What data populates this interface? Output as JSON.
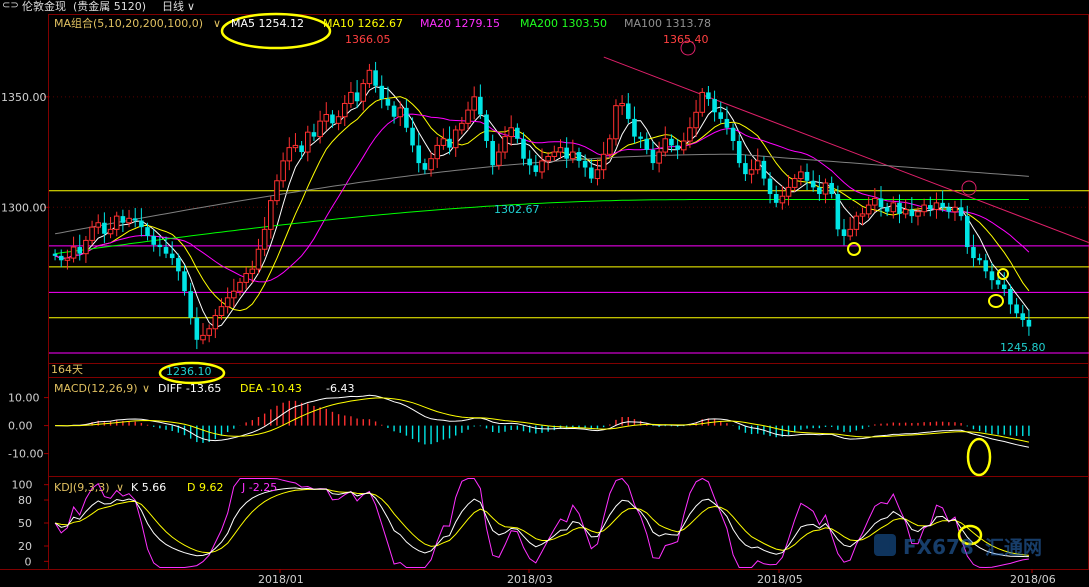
{
  "topbar": {
    "title": "伦敦金现",
    "category": "(贵金属  5120)",
    "period": "日线",
    "period_arrow": "∨"
  },
  "main_panel": {
    "ma_group_label": "MA组合(5,10,20,200,100,0)",
    "ma_group_arrow": "∨",
    "ma5": "MA5 1254.12",
    "ma10": "MA10 1262.67",
    "ma20": "MA20 1279.15",
    "ma200": "MA200 1303.50",
    "ma100": "MA100 1313.78",
    "high_label_1": "1366.05",
    "high_label_2": "1365.40",
    "low_label": "1236.10",
    "last_label": "1245.80",
    "mid_label": "1302.67",
    "days_label": "164天",
    "colors": {
      "ma5": "#ffffff",
      "ma10": "#ffff00",
      "ma20": "#ff00ff",
      "ma200": "#00ff00",
      "ma100": "#808080",
      "up_candle": "#ff3030",
      "down_candle": "#00e5e5",
      "hline_yellow": "#ffff00",
      "hline_magenta": "#ff00ff",
      "trendline": "#e0206a",
      "highlight_circle": "#ffff00"
    }
  },
  "macd_panel": {
    "label": "MACD(12,26,9)",
    "arrow": "∨",
    "diff": "DIFF -13.65",
    "dea": "DEA -10.43",
    "macd": "-6.43"
  },
  "kdj_panel": {
    "label": "KDJ(9,3,3)",
    "arrow": "∨",
    "k": "K 5.66",
    "d": "D 9.62",
    "j": "J -2.25"
  },
  "watermark": {
    "text_1": "FX678",
    "text_2": "汇通网"
  },
  "chart_data": [
    {
      "type": "candlestick",
      "title": "伦敦金现 日线",
      "y_ticks": [
        1300.0,
        1350.0
      ],
      "ylim": [
        1229.5,
        1387.5
      ],
      "x_ticks": [
        "2018/01",
        "2018/03",
        "2018/05",
        "2018/06"
      ],
      "annotations": [
        "1366.05",
        "1365.40",
        "1302.67",
        "1236.10",
        "1245.80"
      ],
      "horizontal_levels": [
        {
          "value": 1307.5,
          "color": "#ffff00"
        },
        {
          "value": 1282.5,
          "color": "#ff00ff"
        },
        {
          "value": 1273.0,
          "color": "#ffff00"
        },
        {
          "value": 1261.5,
          "color": "#ff00ff"
        },
        {
          "value": 1250.0,
          "color": "#ffff00"
        },
        {
          "value": 1234.0,
          "color": "#ff00ff"
        }
      ],
      "series": [
        {
          "name": "MA5",
          "last": 1254.12
        },
        {
          "name": "MA10",
          "last": 1262.67
        },
        {
          "name": "MA20",
          "last": 1279.15
        },
        {
          "name": "MA200",
          "last": 1303.5
        },
        {
          "name": "MA100",
          "last": 1313.78
        }
      ],
      "closes": [
        1278,
        1276,
        1277,
        1282,
        1279,
        1285,
        1291,
        1293,
        1288,
        1290,
        1296,
        1293,
        1295,
        1294,
        1291,
        1287,
        1283,
        1282,
        1279,
        1277,
        1271,
        1262,
        1250,
        1240,
        1242,
        1245,
        1251,
        1255,
        1259,
        1262,
        1266,
        1270,
        1272,
        1281,
        1290,
        1303,
        1312,
        1321,
        1327,
        1328,
        1325,
        1334,
        1332,
        1339,
        1342,
        1338,
        1341,
        1347,
        1352,
        1348,
        1356,
        1362,
        1355,
        1349,
        1346,
        1341,
        1345,
        1336,
        1328,
        1320,
        1317,
        1322,
        1328,
        1331,
        1327,
        1335,
        1338,
        1344,
        1350,
        1342,
        1330,
        1319,
        1325,
        1332,
        1336,
        1331,
        1322,
        1319,
        1316,
        1321,
        1323,
        1325,
        1327,
        1322,
        1325,
        1321,
        1318,
        1313,
        1317,
        1324,
        1331,
        1346,
        1347,
        1340,
        1332,
        1331,
        1326,
        1320,
        1325,
        1331,
        1328,
        1326,
        1330,
        1336,
        1343,
        1352,
        1349,
        1343,
        1340,
        1336,
        1330,
        1320,
        1315,
        1317,
        1321,
        1313,
        1306,
        1302,
        1305,
        1309,
        1313,
        1316,
        1312,
        1309,
        1306,
        1311,
        1306,
        1290,
        1287,
        1290,
        1296,
        1297,
        1301,
        1304,
        1300,
        1298,
        1302,
        1297,
        1299,
        1296,
        1298,
        1301,
        1299,
        1302,
        1300,
        1298,
        1300,
        1296,
        1282,
        1277,
        1276,
        1271,
        1267,
        1265,
        1263,
        1256,
        1252,
        1249,
        1246
      ],
      "macd": {
        "ylim": [
          -18,
          17
        ],
        "y_ticks": [
          10.0,
          0.0,
          -10.0
        ],
        "diff_last": -13.65,
        "dea_last": -10.43,
        "macd_last": -6.43
      },
      "kdj": {
        "ylim": [
          -10,
          110
        ],
        "y_ticks": [
          100,
          80,
          50,
          20,
          0
        ],
        "k_last": 5.66,
        "d_last": 9.62,
        "j_last": -2.25
      }
    }
  ]
}
